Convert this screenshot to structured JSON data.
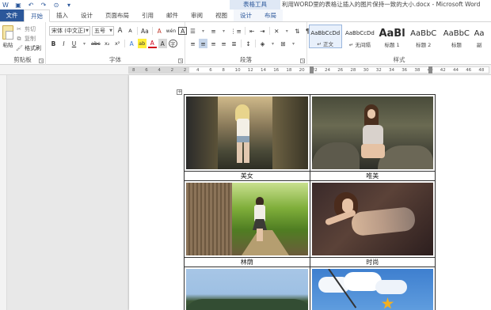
{
  "window": {
    "title": "利用WORD里的表格让插入的图片保持一致的大小.docx - Microsoft Word",
    "context_group": "表格工具"
  },
  "tabs": [
    {
      "label": "文件"
    },
    {
      "label": "开始"
    },
    {
      "label": "插入"
    },
    {
      "label": "设计"
    },
    {
      "label": "页面布局"
    },
    {
      "label": "引用"
    },
    {
      "label": "邮件"
    },
    {
      "label": "审阅"
    },
    {
      "label": "视图"
    },
    {
      "label": "设计"
    },
    {
      "label": "布局"
    }
  ],
  "ribbon": {
    "clipboard": {
      "paste_label": "粘贴",
      "cut_label": "剪切",
      "copy_label": "复制",
      "format_painter_label": "格式刷",
      "group_label": "剪贴板"
    },
    "font": {
      "font_name": "宋体 (中文正)",
      "font_size": "五号",
      "grow_label": "A",
      "shrink_label": "A",
      "case_label": "Aa",
      "clear_label": "A",
      "phonetic_label": "wén",
      "border_label": "A",
      "bold": "B",
      "italic": "I",
      "underline": "U",
      "strike": "abc",
      "subscript": "x₂",
      "superscript": "x²",
      "effects_label": "A",
      "highlight_label": "ab",
      "color_label": "A",
      "shade_label": "A",
      "circle_label": "字",
      "group_label": "字体"
    },
    "paragraph": {
      "group_label": "段落"
    },
    "styles": {
      "items": [
        {
          "sample": "AaBbCcDd",
          "name": "↵ 正文"
        },
        {
          "sample": "AaBbCcDd",
          "name": "↵ 无间隔"
        },
        {
          "sample": "AaBl",
          "name": "标题 1"
        },
        {
          "sample": "AaBbC",
          "name": "标题 2"
        },
        {
          "sample": "AaBbC",
          "name": "标题"
        },
        {
          "sample": "Aa",
          "name": "副"
        }
      ],
      "group_label": "样式"
    }
  },
  "ruler": {
    "numbers": [
      "8",
      "6",
      "4",
      "2",
      "2",
      "4",
      "6",
      "8",
      "10",
      "12",
      "14",
      "16",
      "18",
      "20",
      "22",
      "24",
      "26",
      "28",
      "30",
      "32",
      "34",
      "36",
      "38",
      "40",
      "42",
      "44",
      "46",
      "48"
    ]
  },
  "table": {
    "handle": "+",
    "rows": [
      {
        "captions": [
          "美女",
          "唯美"
        ]
      },
      {
        "captions": [
          "林荫",
          "时尚"
        ]
      }
    ]
  },
  "colors": {
    "accent": "#2b579a",
    "ribbon_bg": "#ffffff",
    "doc_bg": "#e8e8e8"
  }
}
